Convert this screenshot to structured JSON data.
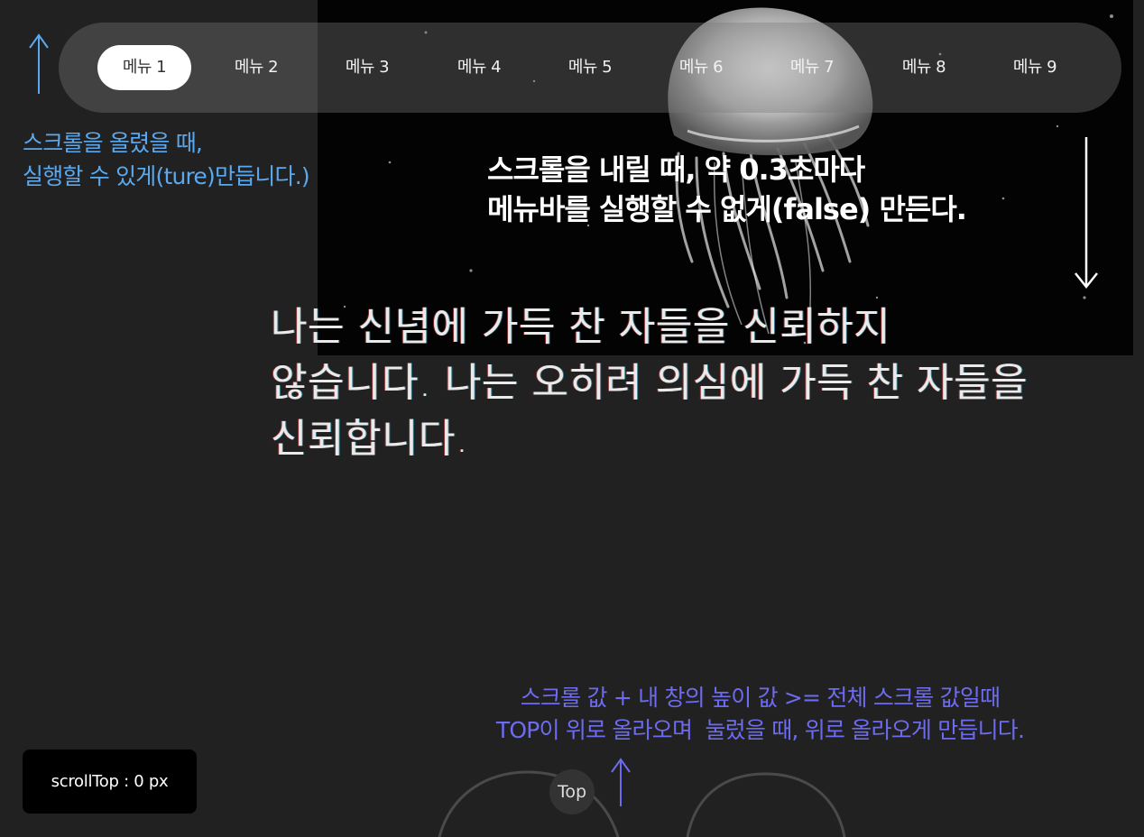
{
  "nav": {
    "items": [
      "메뉴 1",
      "메뉴 2",
      "메뉴 3",
      "메뉴 4",
      "메뉴 5",
      "메뉴 6",
      "메뉴 7",
      "메뉴 8",
      "메뉴 9"
    ],
    "active_index": 0
  },
  "notes": {
    "scroll_up": "스크롤을 올렸을 때,\n실행할 수 있게(ture)만듭니다.)",
    "scroll_down": "스크롤을 내릴 때, 약 0.3초마다\n메뉴바를 실행할 수 없게(false) 만든다.",
    "top_logic": "스크롤 값 + 내 창의 높이 값 >= 전체 스크롤 값일때\nTOP이 위로 올라오며  눌렀을 때, 위로 올라오게 만듭니다."
  },
  "quote": {
    "line1": "나는 신념에 가득 찬 자들을 신뢰하지",
    "line2": "않습니다. 나는 오히려 의심에 가득 찬 자들을",
    "line3": "신뢰합니다."
  },
  "scroll_indicator": "scrollTop : 0 px",
  "top_button": "Top",
  "colors": {
    "background": "#212121",
    "hero": "#030303",
    "note_blue": "#5aa9f0",
    "note_purple": "#6d6bf0"
  },
  "icons": [
    "arrow-up-icon",
    "arrow-down-icon",
    "jellyfish-image"
  ]
}
